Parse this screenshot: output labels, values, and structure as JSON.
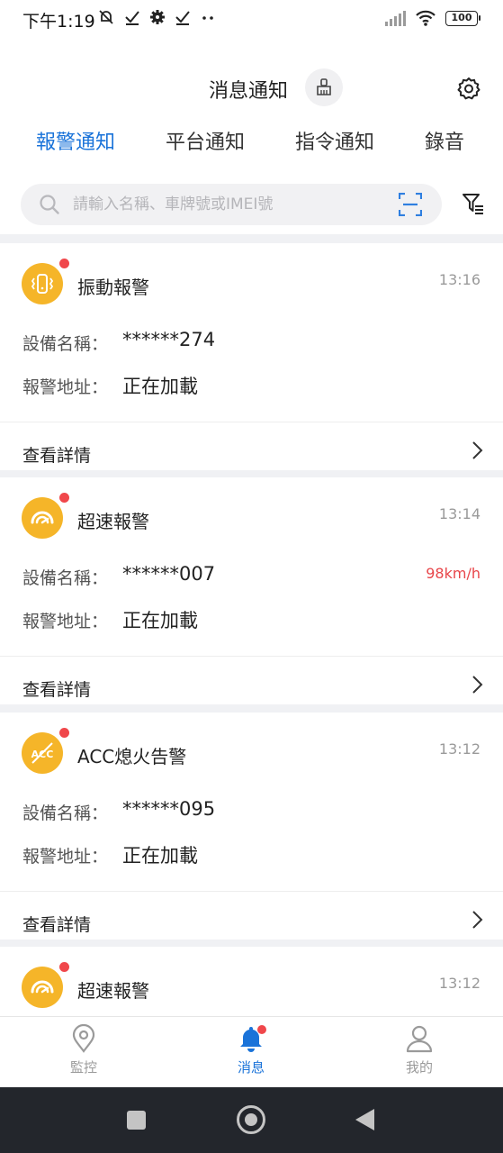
{
  "status_bar": {
    "time": "下午1:19",
    "battery": "100"
  },
  "header": {
    "title": "消息通知"
  },
  "tabs": [
    {
      "label": "報警通知",
      "active": true
    },
    {
      "label": "平台通知",
      "active": false
    },
    {
      "label": "指令通知",
      "active": false
    },
    {
      "label": "錄音",
      "active": false
    }
  ],
  "search": {
    "placeholder": "請輸入名稱、車牌號或IMEI號"
  },
  "labels": {
    "device_name": "設備名稱：",
    "alarm_address": "報警地址：",
    "view_details": "查看詳情"
  },
  "alarms": [
    {
      "title": "振動報警",
      "time": "13:16",
      "device": "******274",
      "address": "正在加載",
      "speed": "",
      "icon": "vibration-icon"
    },
    {
      "title": "超速報警",
      "time": "13:14",
      "device": "******007",
      "address": "正在加載",
      "speed": "98km/h",
      "icon": "speedometer-icon"
    },
    {
      "title": "ACC熄火告警",
      "time": "13:12",
      "device": "******095",
      "address": "正在加載",
      "speed": "",
      "icon": "acc-off-icon"
    },
    {
      "title": "超速報警",
      "time": "13:12",
      "device": "",
      "address": "",
      "speed": "",
      "icon": "speedometer-icon"
    }
  ],
  "bottom_nav": [
    {
      "label": "監控",
      "icon": "location-pin-icon",
      "active": false
    },
    {
      "label": "消息",
      "icon": "bell-icon",
      "active": true
    },
    {
      "label": "我的",
      "icon": "person-icon",
      "active": false
    }
  ],
  "colors": {
    "accent": "#1a73d9",
    "alarm_icon": "#f5b529",
    "badge": "#f0474b",
    "speed": "#e8464a"
  }
}
